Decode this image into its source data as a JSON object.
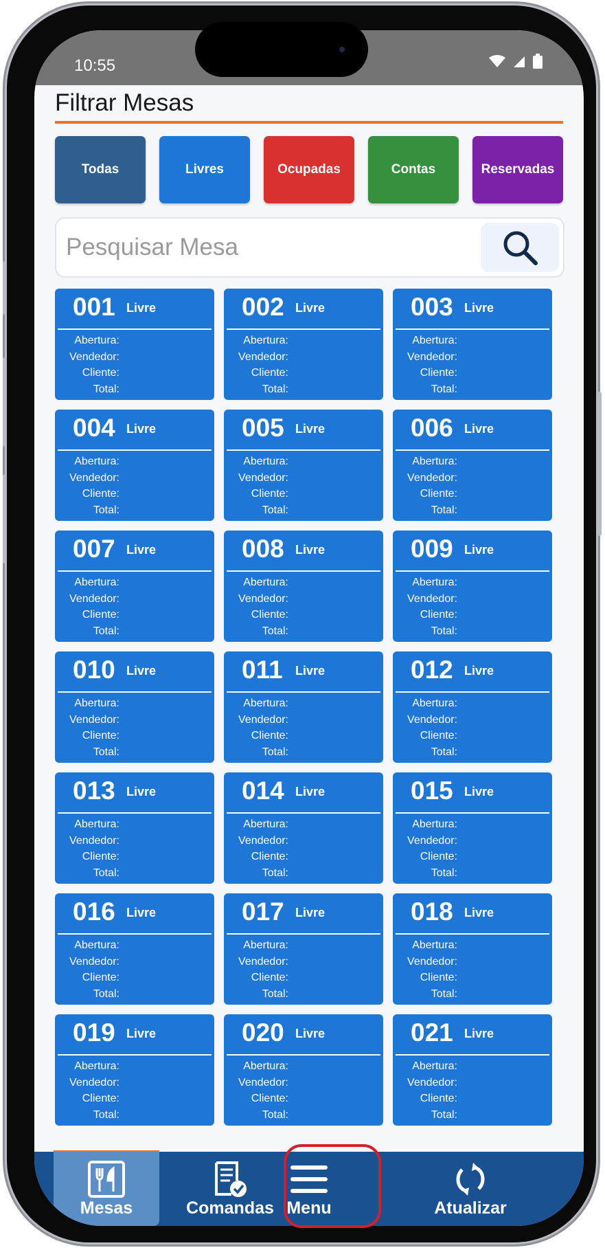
{
  "status_bar": {
    "time": "10:55"
  },
  "header": {
    "title": "Filtrar Mesas"
  },
  "filters": [
    {
      "label": "Todas",
      "color": "#2f5f8f"
    },
    {
      "label": "Livres",
      "color": "#1e77d6"
    },
    {
      "label": "Ocupadas",
      "color": "#d93030"
    },
    {
      "label": "Contas",
      "color": "#36913e"
    },
    {
      "label": "Reservadas",
      "color": "#7b22a8"
    }
  ],
  "search": {
    "placeholder": "Pesquisar Mesa",
    "icon": "search-icon"
  },
  "card_fields": {
    "abertura": "Abertura:",
    "vendedor": "Vendedor:",
    "cliente": "Cliente:",
    "total": "Total:"
  },
  "tables": [
    {
      "number": "001",
      "status": "Livre"
    },
    {
      "number": "002",
      "status": "Livre"
    },
    {
      "number": "003",
      "status": "Livre"
    },
    {
      "number": "004",
      "status": "Livre"
    },
    {
      "number": "005",
      "status": "Livre"
    },
    {
      "number": "006",
      "status": "Livre"
    },
    {
      "number": "007",
      "status": "Livre"
    },
    {
      "number": "008",
      "status": "Livre"
    },
    {
      "number": "009",
      "status": "Livre"
    },
    {
      "number": "010",
      "status": "Livre"
    },
    {
      "number": "011",
      "status": "Livre"
    },
    {
      "number": "012",
      "status": "Livre"
    },
    {
      "number": "013",
      "status": "Livre"
    },
    {
      "number": "014",
      "status": "Livre"
    },
    {
      "number": "015",
      "status": "Livre"
    },
    {
      "number": "016",
      "status": "Livre"
    },
    {
      "number": "017",
      "status": "Livre"
    },
    {
      "number": "018",
      "status": "Livre"
    },
    {
      "number": "019",
      "status": "Livre"
    },
    {
      "number": "020",
      "status": "Livre"
    },
    {
      "number": "021",
      "status": "Livre"
    }
  ],
  "bottom_nav": [
    {
      "label": "Mesas",
      "icon": "cutlery-icon",
      "active": true
    },
    {
      "label": "Comandas",
      "icon": "receipt-check-icon",
      "active": false
    },
    {
      "label": "Menu",
      "icon": "hamburger-menu-icon",
      "active": false
    },
    {
      "label": "Atualizar",
      "icon": "refresh-icon",
      "active": false
    }
  ],
  "colors": {
    "accent": "#f07021",
    "card": "#1e77d6",
    "nav": "#1a5190",
    "highlight": "#d21f2d"
  }
}
